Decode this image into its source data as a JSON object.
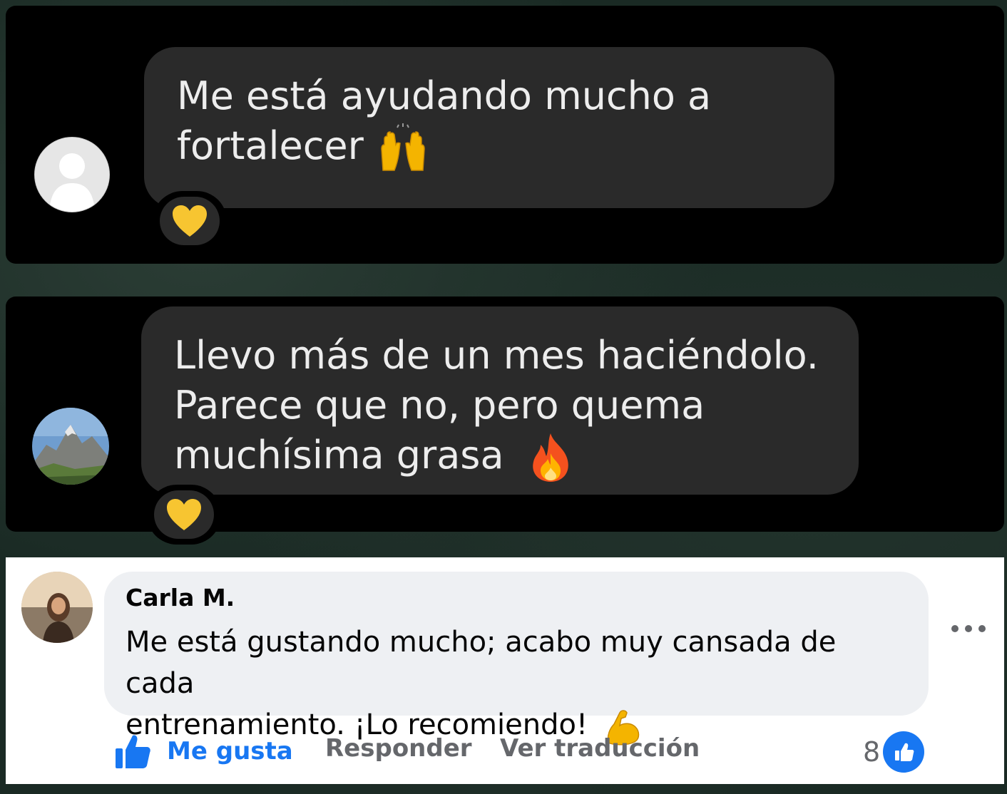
{
  "messages": [
    {
      "text_line1": "Me está ayudando mucho a",
      "text_line2": "fortalecer",
      "emoji": "raising-hands",
      "reaction": "yellow-heart"
    },
    {
      "text_line1": "Llevo más de un mes haciéndolo.",
      "text_line2": "Parece que no, pero quema",
      "text_line3": "muchísima grasa",
      "emoji": "fire",
      "reaction": "yellow-heart"
    }
  ],
  "comment": {
    "author": "Carla M.",
    "text_line1": "Me está gustando mucho; acabo muy cansada de cada",
    "text_line2": "entrenamiento. ¡Lo recomiendo!",
    "emoji": "flexed-biceps",
    "actions": {
      "like": "Me gusta",
      "reply": "Responder",
      "translate": "Ver traducción"
    },
    "like_count": "8"
  },
  "colors": {
    "chat_panel": "#000000",
    "chat_bubble": "#2a2a2a",
    "chat_text": "#ededed",
    "fb_blue": "#1877f2",
    "fb_grey_text": "#65676b",
    "fb_bubble": "#eef0f3"
  }
}
